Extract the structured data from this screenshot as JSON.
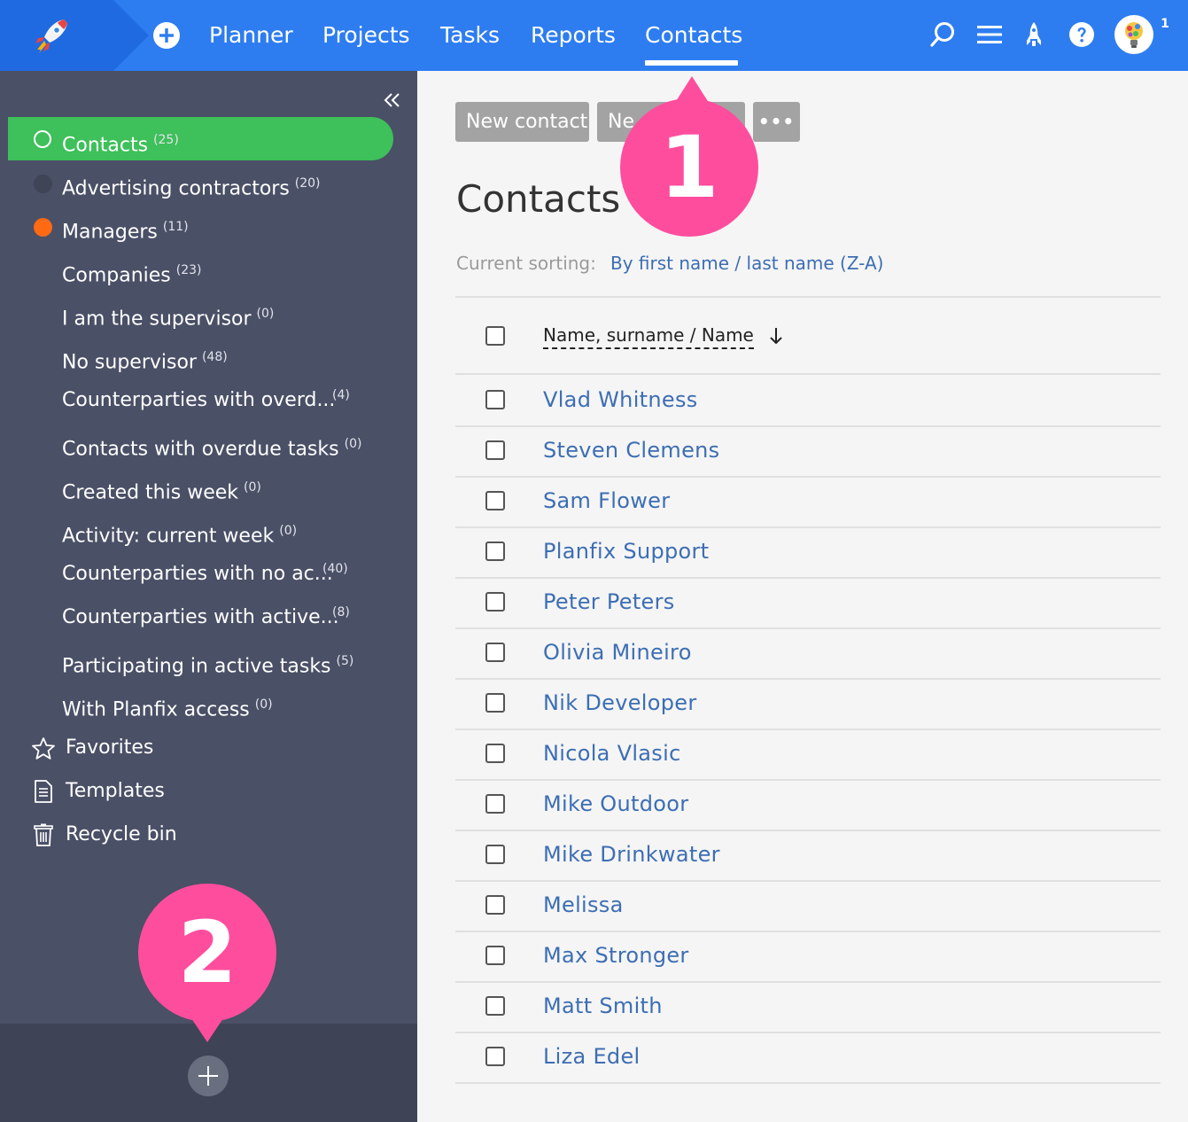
{
  "topbar": {
    "nav": [
      {
        "label": "Planner"
      },
      {
        "label": "Projects"
      },
      {
        "label": "Tasks"
      },
      {
        "label": "Reports"
      },
      {
        "label": "Contacts",
        "active": true
      }
    ],
    "notification_count": "1",
    "icons": [
      "rocket-logo-icon",
      "plus-circle-icon",
      "search-icon",
      "menu-icon",
      "rocket-icon",
      "help-icon",
      "avatar"
    ],
    "accent_color": "#2e7df0"
  },
  "sidebar": {
    "items": [
      {
        "label": "Contacts",
        "count": "(25)",
        "active": true
      },
      {
        "label": "Advertising contractors",
        "count": "(20)",
        "dot_color": "#3f4457"
      },
      {
        "label": "Managers",
        "count": "(11)",
        "dot_color": "#ff6a13"
      },
      {
        "label": "Companies",
        "count": "(23)"
      },
      {
        "label": "I am the supervisor",
        "count": "(0)"
      },
      {
        "label": "No supervisor",
        "count": "(48)"
      },
      {
        "label": "Counterparties with overd...",
        "count": "(4)"
      },
      {
        "label": "Contacts with overdue tasks",
        "count": "(0)"
      },
      {
        "label": "Created this week",
        "count": "(0)"
      },
      {
        "label": "Activity: current week",
        "count": "(0)"
      },
      {
        "label": "Counterparties with no ac...",
        "count": "(40)"
      },
      {
        "label": "Counterparties with active...",
        "count": "(8)"
      },
      {
        "label": "Participating in active tasks",
        "count": "(5)"
      },
      {
        "label": "With Planfix access",
        "count": "(0)"
      }
    ],
    "bottom": [
      {
        "label": "Favorites",
        "icon": "star-icon"
      },
      {
        "label": "Templates",
        "icon": "document-icon"
      },
      {
        "label": "Recycle bin",
        "icon": "trash-icon"
      }
    ],
    "active_color": "#3ec05a"
  },
  "main": {
    "toolbar": {
      "new_contact": "New contact",
      "new_company": "Ne",
      "more": "•••"
    },
    "title": "Contacts",
    "sorting_label": "Current sorting:",
    "sorting_value": "By first name / last name (Z-A)",
    "column_header": "Name, surname / Name",
    "contacts": [
      "Vlad Whitness",
      "Steven Clemens",
      "Sam Flower",
      "Planfix Support",
      "Peter Peters",
      "Olivia Mineiro",
      "Nik Developer",
      "Nicola Vlasic",
      "Mike Outdoor",
      "Mike Drinkwater",
      "Melissa",
      "Max Stronger",
      "Matt Smith",
      "Liza Edel"
    ]
  },
  "callouts": {
    "one": "1",
    "two": "2",
    "color": "#ff4d9e"
  }
}
